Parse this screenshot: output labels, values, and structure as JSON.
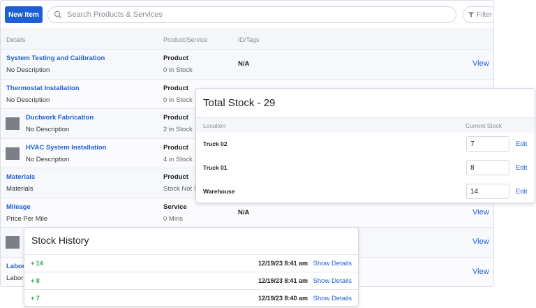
{
  "toolbar": {
    "new_item_label": "New Item",
    "search_placeholder": "Search Products & Services",
    "filter_label": "Filter"
  },
  "table": {
    "columns": [
      "Details",
      "Product/Service",
      "ID/Tags"
    ],
    "rows": [
      {
        "title": "System Testing and Calibration",
        "description": "No Description",
        "type": "Product",
        "stock": "0 in Stock",
        "tags": "N/A",
        "action": "View"
      },
      {
        "title": "Thermostat Installation",
        "description": "No Description",
        "type": "Product",
        "stock": "0 in Stock",
        "tags": "",
        "action": ""
      },
      {
        "title": "Ductwork Fabrication",
        "description": "No Description",
        "type": "Product",
        "stock": "2 in Stock",
        "tags": "",
        "action": ""
      },
      {
        "title": "HVAC System Installation",
        "description": "No Description",
        "type": "Product",
        "stock": "4 in Stock",
        "tags": "",
        "action": ""
      },
      {
        "title": "Materials",
        "description": "Materials",
        "type": "Product",
        "stock": "Stock Not S",
        "tags": "",
        "action": ""
      },
      {
        "title": "Mileage",
        "description": "Price Per Mile",
        "type": "Service",
        "stock": "0 Mins",
        "tags": "N/A",
        "action": "View"
      },
      {
        "title": "",
        "description": "",
        "type": "",
        "stock": "",
        "tags": "",
        "action": "View"
      },
      {
        "title": "Labor",
        "description": "Labor",
        "type": "",
        "stock": "",
        "tags": "",
        "action": "View"
      }
    ]
  },
  "stock_popup": {
    "title": "Total Stock - 29",
    "columns": [
      "Location",
      "Current Stock"
    ],
    "rows": [
      {
        "location": "Truck 02",
        "stock": "7",
        "edit": "Edit"
      },
      {
        "location": "Truck 01",
        "stock": "8",
        "edit": "Edit"
      },
      {
        "location": "Warehouse",
        "stock": "14",
        "edit": "Edit"
      }
    ]
  },
  "stock_history": {
    "title": "Stock History",
    "rows": [
      {
        "qty": "14",
        "timestamp": "12/19/23 8:41 am",
        "action": "Show Details"
      },
      {
        "qty": "8",
        "timestamp": "12/19/23 8:41 am",
        "action": "Show Details"
      },
      {
        "qty": "7",
        "timestamp": "12/19/23 8:40 am",
        "action": "Show Details"
      }
    ]
  },
  "colors": {
    "accent": "#1f5fd6",
    "positive": "#2ea84a"
  }
}
